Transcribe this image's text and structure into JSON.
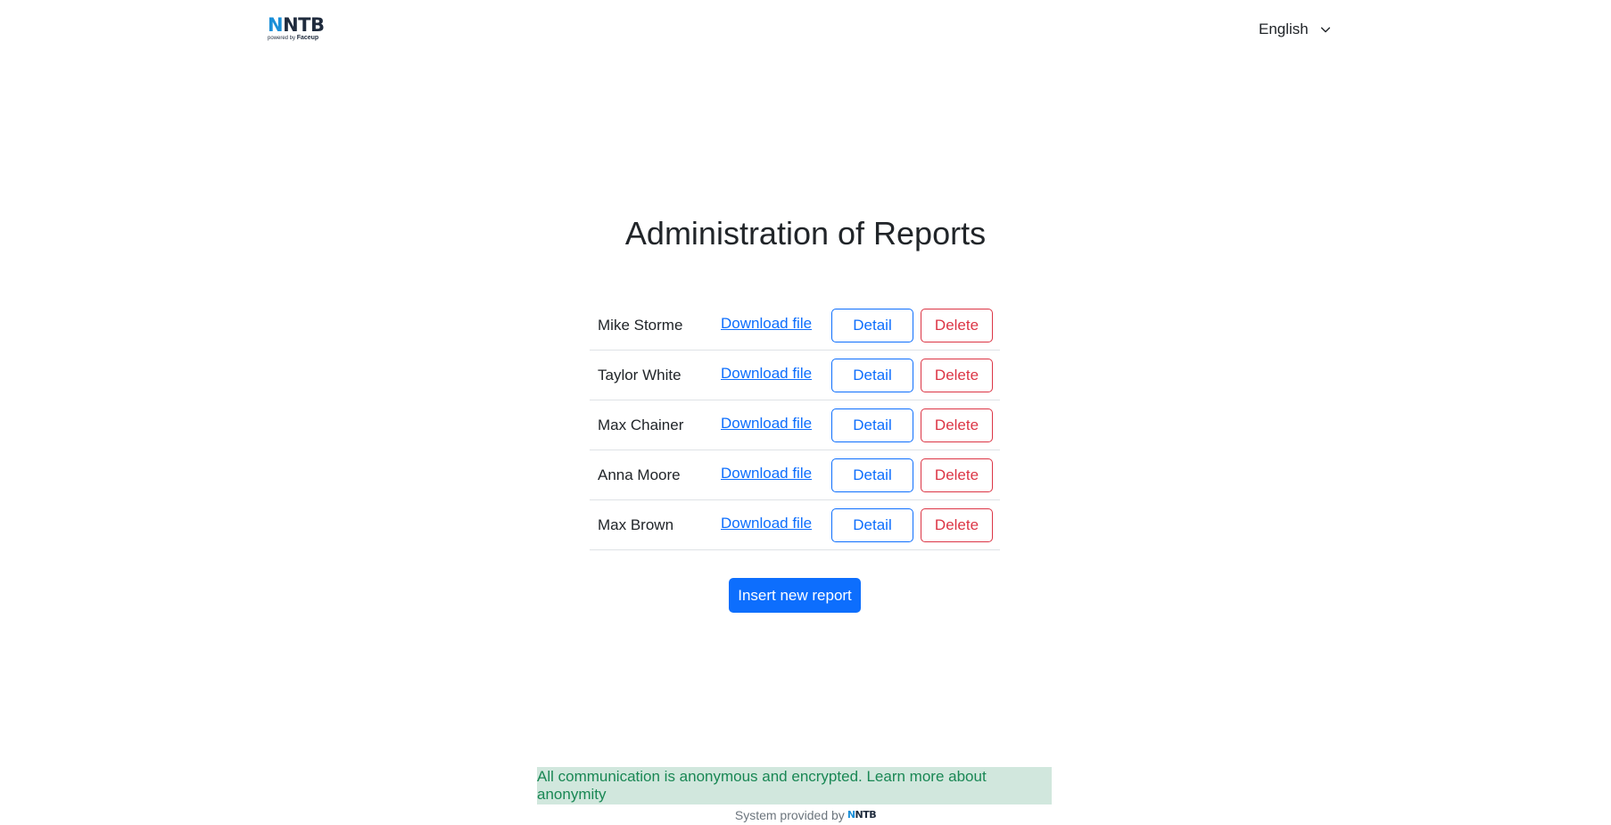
{
  "header": {
    "logo": {
      "text_first": "N",
      "text_rest": "NTB",
      "tagline_prefix": "powered by",
      "tagline_brand": "Faceup"
    },
    "language": {
      "selected": "English"
    }
  },
  "main": {
    "title": "Administration of Reports",
    "rows": [
      {
        "name": "Mike Storme",
        "download": "Download file",
        "detail": "Detail",
        "delete": "Delete"
      },
      {
        "name": "Taylor White",
        "download": "Download file",
        "detail": "Detail",
        "delete": "Delete"
      },
      {
        "name": "Max Chainer",
        "download": "Download file",
        "detail": "Detail",
        "delete": "Delete"
      },
      {
        "name": "Anna Moore",
        "download": "Download file",
        "detail": "Detail",
        "delete": "Delete"
      },
      {
        "name": "Max Brown",
        "download": "Download file",
        "detail": "Detail",
        "delete": "Delete"
      }
    ],
    "insert_label": "Insert new report"
  },
  "footer": {
    "notice": "All communication is anonymous and encrypted. Learn more about anonymity",
    "provided_by": "System provided by",
    "mini_logo_first": "N",
    "mini_logo_rest": "NTB"
  },
  "colors": {
    "primary": "#0d6efd",
    "danger": "#dc3545",
    "notice_bg": "#d1e7dd",
    "notice_text": "#198754",
    "logo_accent": "#1a8fd8"
  }
}
